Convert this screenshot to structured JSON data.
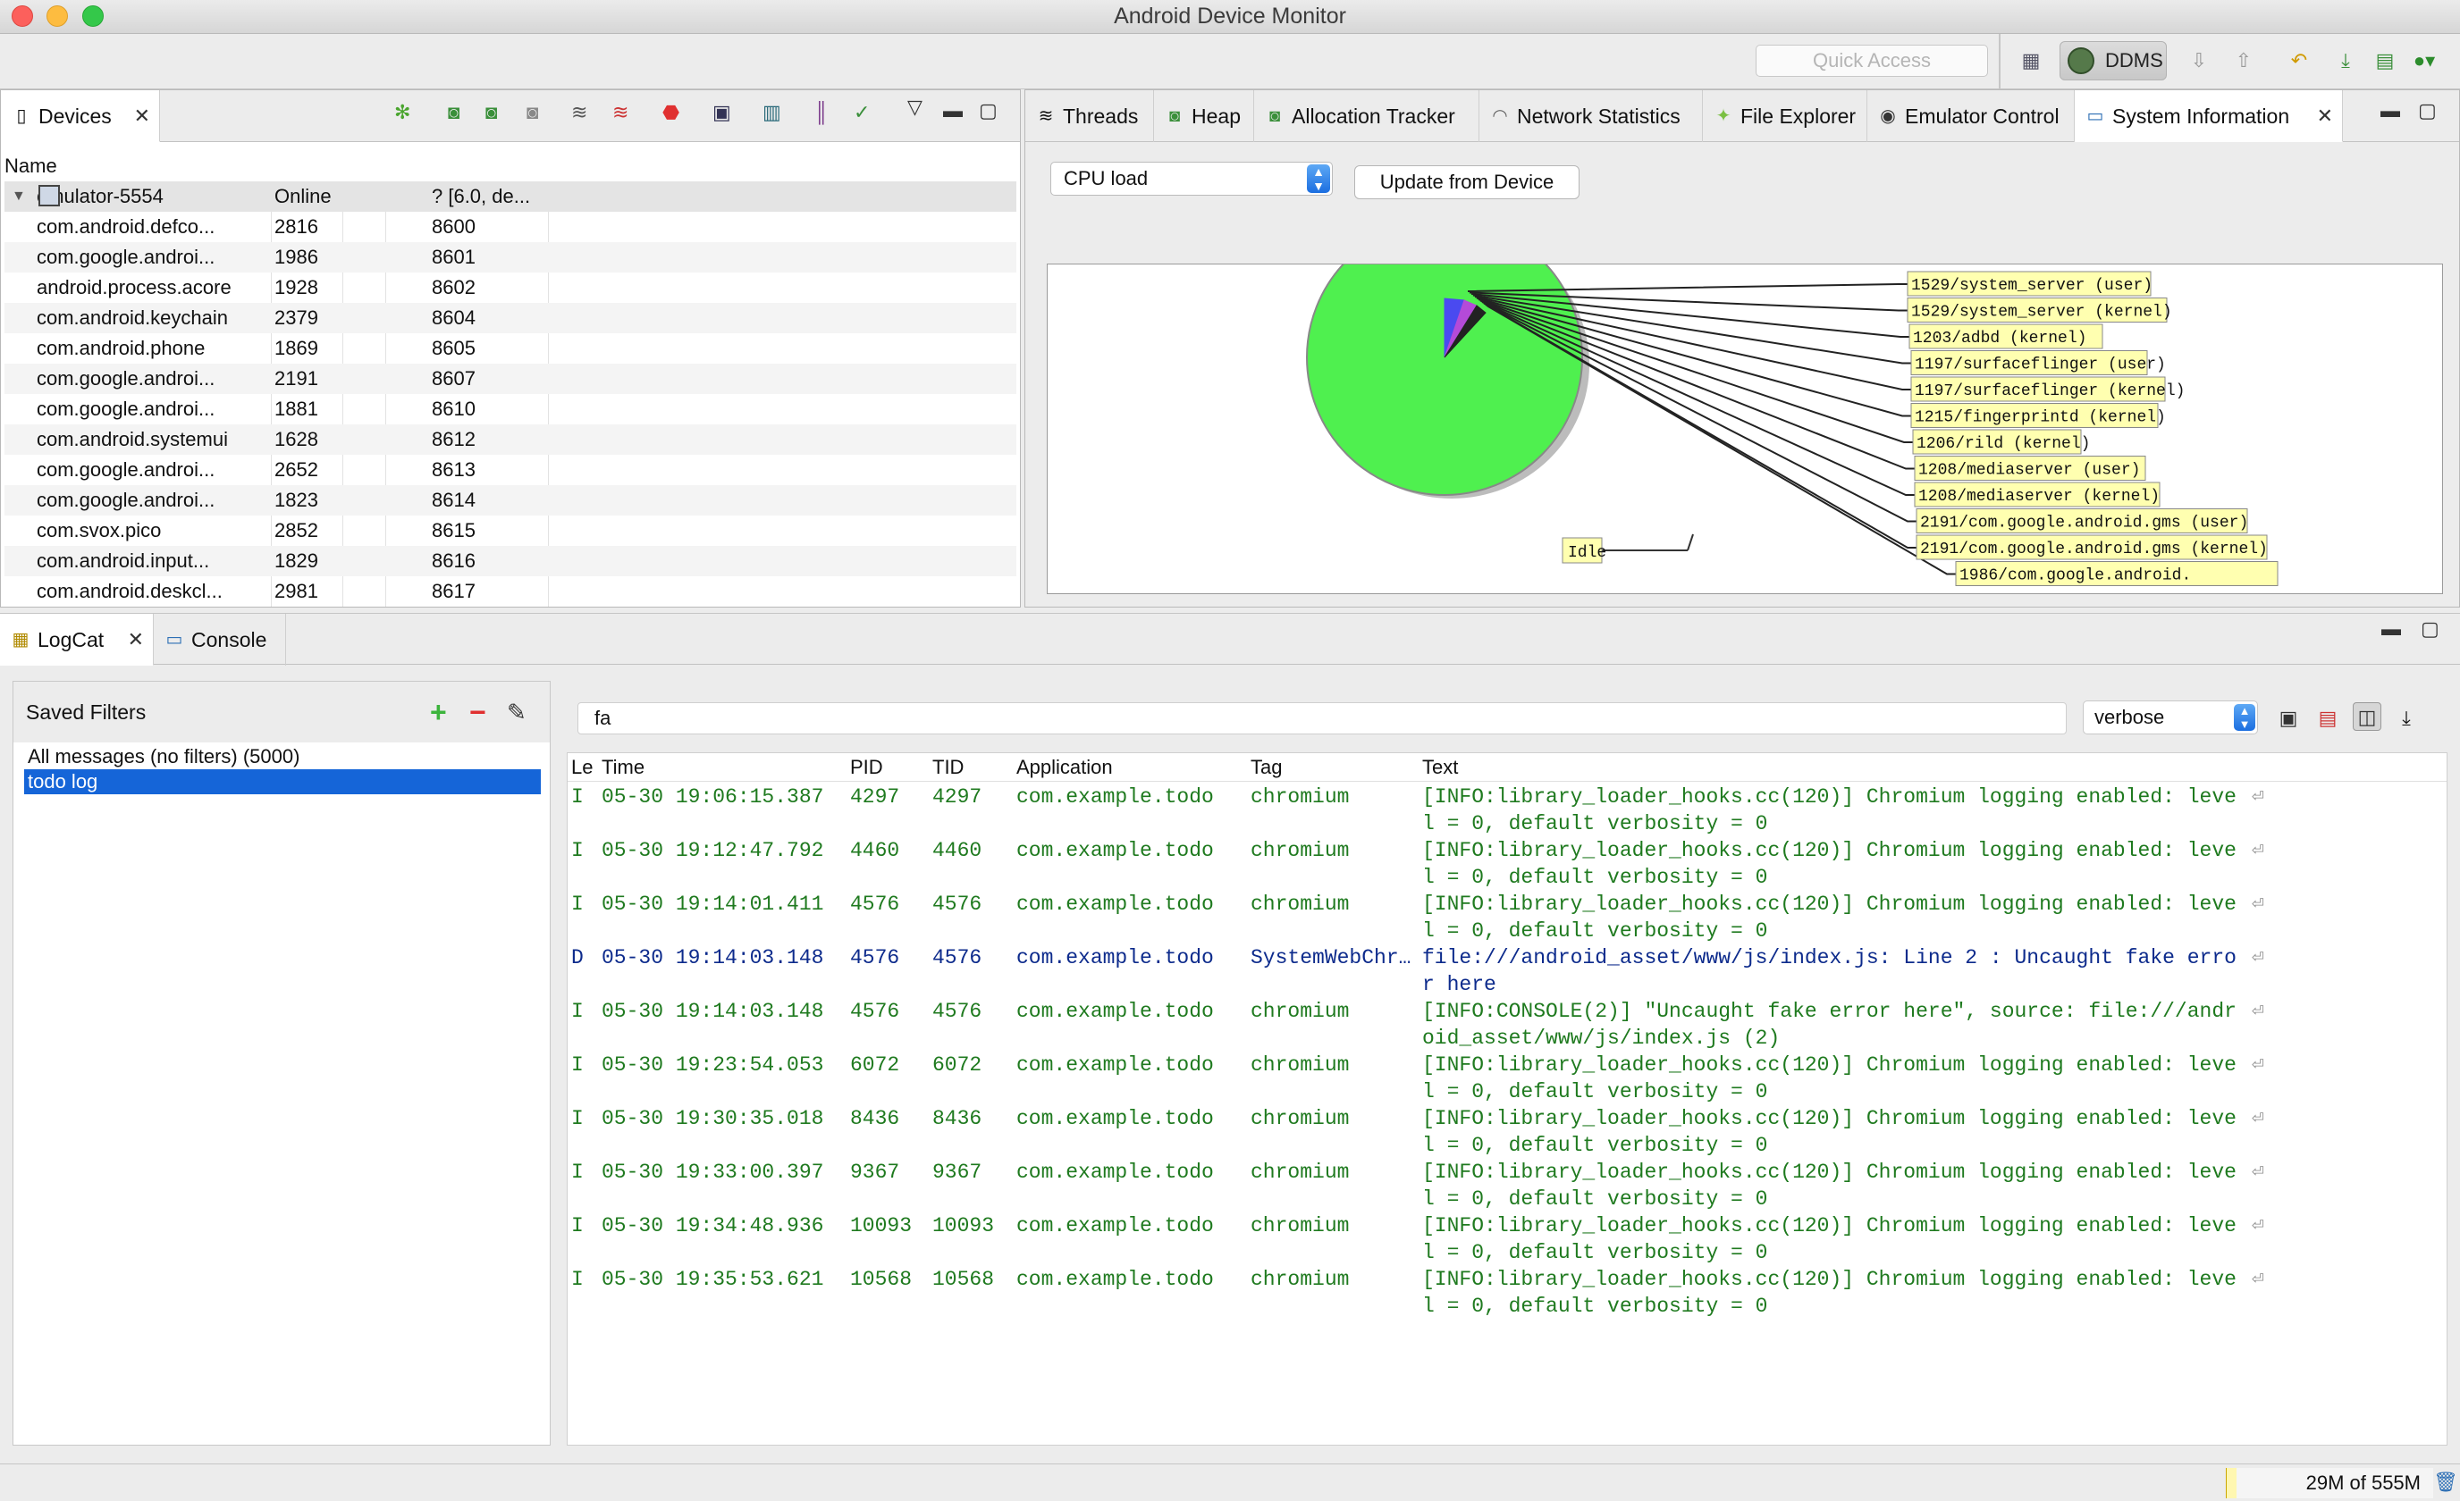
{
  "window": {
    "title": "Android Device Monitor"
  },
  "toolbar": {
    "quick_access_placeholder": "Quick Access",
    "perspective": "DDMS"
  },
  "devices_panel": {
    "tab_label": "Devices",
    "columns": [
      "Name",
      "",
      "",
      ""
    ],
    "device": {
      "name": "emulator-5554",
      "status": "Online",
      "info": "? [6.0, de..."
    },
    "processes": [
      {
        "name": "com.android.defco...",
        "pid": "2816",
        "port": "8600"
      },
      {
        "name": "com.google.androi...",
        "pid": "1986",
        "port": "8601"
      },
      {
        "name": "android.process.acore",
        "pid": "1928",
        "port": "8602"
      },
      {
        "name": "com.android.keychain",
        "pid": "2379",
        "port": "8604"
      },
      {
        "name": "com.android.phone",
        "pid": "1869",
        "port": "8605"
      },
      {
        "name": "com.google.androi...",
        "pid": "2191",
        "port": "8607"
      },
      {
        "name": "com.google.androi...",
        "pid": "1881",
        "port": "8610"
      },
      {
        "name": "com.android.systemui",
        "pid": "1628",
        "port": "8612"
      },
      {
        "name": "com.google.androi...",
        "pid": "2652",
        "port": "8613"
      },
      {
        "name": "com.google.androi...",
        "pid": "1823",
        "port": "8614"
      },
      {
        "name": "com.svox.pico",
        "pid": "2852",
        "port": "8615"
      },
      {
        "name": "com.android.input...",
        "pid": "1829",
        "port": "8616"
      },
      {
        "name": "com.android.deskcl...",
        "pid": "2981",
        "port": "8617"
      }
    ]
  },
  "sysinfo_panel": {
    "tabs": [
      "Threads",
      "Heap",
      "Allocation Tracker",
      "Network Statistics",
      "File Explorer",
      "Emulator Control",
      "System Information"
    ],
    "active_tab": "System Information",
    "select_value": "CPU load",
    "update_button": "Update from Device",
    "pie_legend": [
      "1529/system_server (user)",
      "1529/system_server (kernel)",
      "1203/adbd (kernel)",
      "1197/surfaceflinger (user)",
      "1197/surfaceflinger (kernel)",
      "1215/fingerprintd (kernel)",
      "1206/rild (kernel)",
      "1208/mediaserver (user)",
      "1208/mediaserver (kernel)",
      "2191/com.google.android.gms (user)",
      "2191/com.google.android.gms (kernel)",
      "1986/com.google.android."
    ],
    "idle_label": "Idle",
    "colors": {
      "idle": "#4ff04f",
      "user": "#4a4af0",
      "kernel": "#b44ad8",
      "label_bg": "#ffffb0"
    }
  },
  "logcat_panel": {
    "tabs": [
      "LogCat",
      "Console"
    ],
    "saved_filters_title": "Saved Filters",
    "filters": [
      "All messages (no filters) (5000)",
      "todo log"
    ],
    "selected_filter": "todo log",
    "search_value": "fa",
    "level_value": "verbose",
    "columns": [
      "Le",
      "Time",
      "PID",
      "TID",
      "Application",
      "Tag",
      "Text"
    ],
    "rows": [
      {
        "level": "I",
        "time": "05-30 19:06:15.387",
        "pid": "4297",
        "tid": "4297",
        "app": "com.example.todo",
        "tag": "chromium",
        "text1": "[INFO:library_loader_hooks.cc(120)] Chromium logging enabled: leve",
        "text2": "l = 0, default verbosity = 0"
      },
      {
        "level": "I",
        "time": "05-30 19:12:47.792",
        "pid": "4460",
        "tid": "4460",
        "app": "com.example.todo",
        "tag": "chromium",
        "text1": "[INFO:library_loader_hooks.cc(120)] Chromium logging enabled: leve",
        "text2": "l = 0, default verbosity = 0"
      },
      {
        "level": "I",
        "time": "05-30 19:14:01.411",
        "pid": "4576",
        "tid": "4576",
        "app": "com.example.todo",
        "tag": "chromium",
        "text1": "[INFO:library_loader_hooks.cc(120)] Chromium logging enabled: leve",
        "text2": "l = 0, default verbosity = 0"
      },
      {
        "level": "D",
        "time": "05-30 19:14:03.148",
        "pid": "4576",
        "tid": "4576",
        "app": "com.example.todo",
        "tag": "SystemWebChr…",
        "text1": "file:///android_asset/www/js/index.js: Line 2 : Uncaught fake erro",
        "text2": "r here"
      },
      {
        "level": "I",
        "time": "05-30 19:14:03.148",
        "pid": "4576",
        "tid": "4576",
        "app": "com.example.todo",
        "tag": "chromium",
        "text1": "[INFO:CONSOLE(2)] \"Uncaught fake error here\", source: file:///andr",
        "text2": "oid_asset/www/js/index.js (2)"
      },
      {
        "level": "I",
        "time": "05-30 19:23:54.053",
        "pid": "6072",
        "tid": "6072",
        "app": "com.example.todo",
        "tag": "chromium",
        "text1": "[INFO:library_loader_hooks.cc(120)] Chromium logging enabled: leve",
        "text2": "l = 0, default verbosity = 0"
      },
      {
        "level": "I",
        "time": "05-30 19:30:35.018",
        "pid": "8436",
        "tid": "8436",
        "app": "com.example.todo",
        "tag": "chromium",
        "text1": "[INFO:library_loader_hooks.cc(120)] Chromium logging enabled: leve",
        "text2": "l = 0, default verbosity = 0"
      },
      {
        "level": "I",
        "time": "05-30 19:33:00.397",
        "pid": "9367",
        "tid": "9367",
        "app": "com.example.todo",
        "tag": "chromium",
        "text1": "[INFO:library_loader_hooks.cc(120)] Chromium logging enabled: leve",
        "text2": "l = 0, default verbosity = 0"
      },
      {
        "level": "I",
        "time": "05-30 19:34:48.936",
        "pid": "10093",
        "tid": "10093",
        "app": "com.example.todo",
        "tag": "chromium",
        "text1": "[INFO:library_loader_hooks.cc(120)] Chromium logging enabled: leve",
        "text2": "l = 0, default verbosity = 0"
      },
      {
        "level": "I",
        "time": "05-30 19:35:53.621",
        "pid": "10568",
        "tid": "10568",
        "app": "com.example.todo",
        "tag": "chromium",
        "text1": "[INFO:library_loader_hooks.cc(120)] Chromium logging enabled: leve",
        "text2": "l = 0, default verbosity = 0"
      }
    ]
  },
  "statusbar": {
    "memory": "29M of 555M"
  }
}
